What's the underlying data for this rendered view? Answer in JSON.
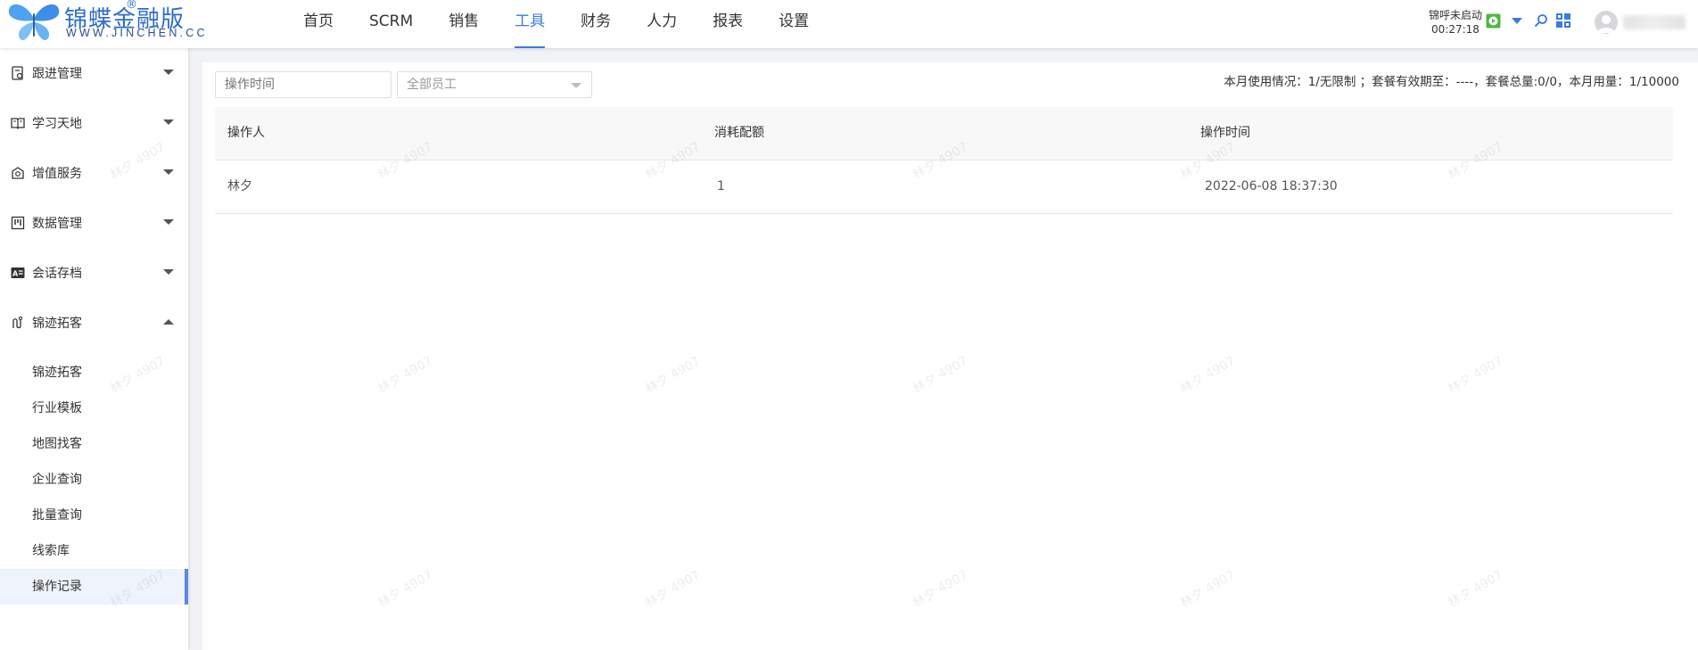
{
  "brand": {
    "name": "锦蝶金融版",
    "registered_mark": "®",
    "domain": "WWW.JINCHEN.CC"
  },
  "nav": {
    "items": [
      {
        "label": "首页",
        "active": false
      },
      {
        "label": "SCRM",
        "active": false
      },
      {
        "label": "销售",
        "active": false
      },
      {
        "label": "工具",
        "active": true
      },
      {
        "label": "财务",
        "active": false
      },
      {
        "label": "人力",
        "active": false
      },
      {
        "label": "报表",
        "active": false
      },
      {
        "label": "设置",
        "active": false
      }
    ],
    "accent_color": "#3a7be0"
  },
  "toolbar": {
    "call_status": "锦呼未启动",
    "call_timer": "00:27:18",
    "icons": [
      "play-icon",
      "dropdown-caret-icon",
      "search-icon",
      "grid-apps-icon",
      "user-avatar-icon"
    ]
  },
  "sidebar": {
    "groups": [
      {
        "label": "跟进管理",
        "icon": "follow-up-icon",
        "expanded": false
      },
      {
        "label": "学习天地",
        "icon": "book-icon",
        "expanded": false
      },
      {
        "label": "增值服务",
        "icon": "value-service-icon",
        "expanded": false
      },
      {
        "label": "数据管理",
        "icon": "data-management-icon",
        "expanded": false
      },
      {
        "label": "会话存档",
        "icon": "chat-archive-icon",
        "expanded": false
      },
      {
        "label": "锦迹拓客",
        "icon": "prospecting-icon",
        "expanded": true
      }
    ],
    "sub_items": [
      {
        "label": "锦迹拓客",
        "active": false
      },
      {
        "label": "行业模板",
        "active": false
      },
      {
        "label": "地图找客",
        "active": false
      },
      {
        "label": "企业查询",
        "active": false
      },
      {
        "label": "批量查询",
        "active": false
      },
      {
        "label": "线索库",
        "active": false
      },
      {
        "label": "操作记录",
        "active": true
      }
    ]
  },
  "filters": {
    "time_placeholder": "操作时间",
    "employee_select": "全部员工"
  },
  "usage_text": "本月使用情况：1/无限制 ；套餐有效期至：----，套餐总量:0/0，本月用量：1/10000",
  "table": {
    "columns": [
      "操作人",
      "消耗配额",
      "操作时间"
    ],
    "rows": [
      {
        "operator": "林夕",
        "quota": "1",
        "time": "2022-06-08 18:37:30"
      }
    ]
  },
  "watermark_text": "林夕 4907"
}
